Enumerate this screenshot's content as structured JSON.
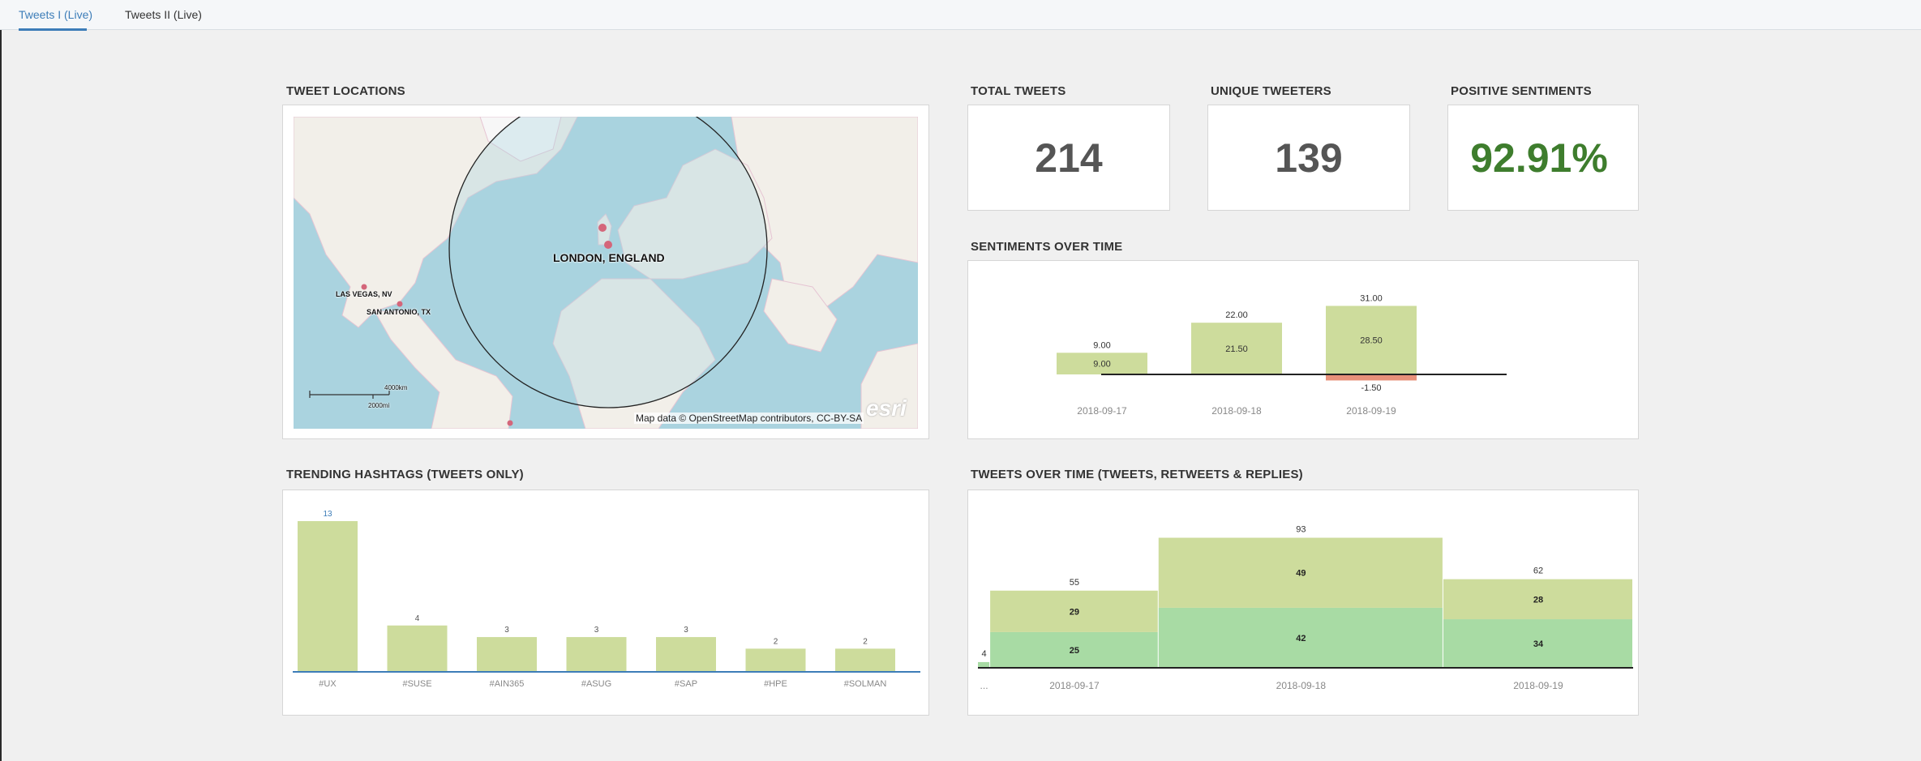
{
  "tabs": [
    {
      "label": "Tweets I (Live)",
      "active": true
    },
    {
      "label": "Tweets II (Live)",
      "active": false
    }
  ],
  "panels": {
    "tweet_locations": {
      "title": "TWEET LOCATIONS",
      "places": [
        "LONDON, ENGLAND",
        "LAS VEGAS, NV",
        "SAN ANTONIO, TX"
      ],
      "scale_km": "4000km",
      "scale_mi": "2000mi",
      "attribution": "Map data © OpenStreetMap contributors, CC-BY-SA",
      "logo": "esri",
      "marker_color": "#d4667a"
    },
    "total_tweets": {
      "title": "TOTAL TWEETS",
      "value": "214"
    },
    "unique_tweeters": {
      "title": "UNIQUE TWEETERS",
      "value": "139"
    },
    "positive_sentiments": {
      "title": "POSITIVE SENTIMENTS",
      "value": "92.91%",
      "color": "#3e7d2d"
    },
    "sentiments_over_time": {
      "title": "SENTIMENTS OVER TIME"
    },
    "trending_hashtags": {
      "title": "TRENDING HASHTAGS (TWEETS ONLY)"
    },
    "tweets_over_time": {
      "title": "TWEETS OVER TIME (TWEETS, RETWEETS & REPLIES)"
    }
  },
  "chart_data": [
    {
      "id": "sentiments",
      "type": "bar",
      "categories": [
        "2018-09-17",
        "2018-09-18",
        "2018-09-19"
      ],
      "series": [
        {
          "values": [
            9.0,
            21.5,
            28.5
          ],
          "color": "#cddc9c"
        },
        {
          "values": [
            0,
            0,
            -1.5
          ],
          "color": "#e8917a"
        }
      ],
      "totals": [
        "9.00",
        "22.00",
        "31.00"
      ],
      "segment_labels": [
        "9.00",
        "21.50",
        "28.50"
      ],
      "negative_labels": [
        "",
        "",
        "-1.50"
      ],
      "ylim": [
        -1.5,
        31
      ]
    },
    {
      "id": "hashtags",
      "type": "bar",
      "categories": [
        "#UX",
        "#SUSE",
        "#AIN365",
        "#ASUG",
        "#SAP",
        "#HPE",
        "#SOLMAN"
      ],
      "values": [
        13,
        4,
        3,
        3,
        3,
        2,
        2
      ],
      "color": "#cddc9c",
      "ylim": [
        0,
        13
      ]
    },
    {
      "id": "tweets_over_time",
      "type": "bar",
      "categories": [
        "...",
        "2018-09-17",
        "2018-09-18",
        "2018-09-19"
      ],
      "width_values": [
        4,
        55,
        93,
        62
      ],
      "series": [
        {
          "values": [
            4,
            25,
            42,
            34
          ],
          "color": "#a8dba4"
        },
        {
          "values": [
            0,
            29,
            49,
            28
          ],
          "color": "#cddc9c"
        }
      ],
      "totals": [
        "4",
        "55",
        "93",
        "62"
      ],
      "ylim": [
        0,
        93
      ]
    }
  ]
}
